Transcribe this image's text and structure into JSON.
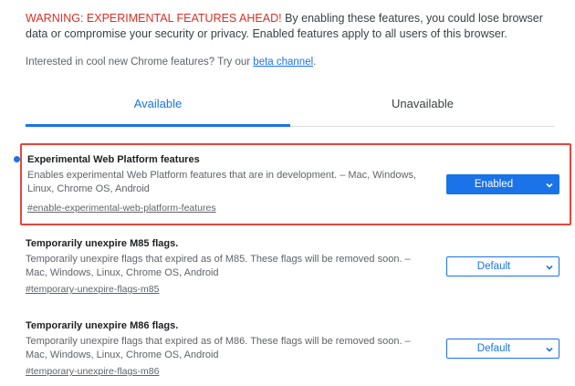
{
  "warning": {
    "heading": "WARNING: EXPERIMENTAL FEATURES AHEAD!",
    "body": " By enabling these features, you could lose browser data or compromise your security or privacy. Enabled features apply to all users of this browser."
  },
  "interest": {
    "text": "Interested in cool new Chrome features? Try our ",
    "link": "beta channel",
    "suffix": "."
  },
  "tabs": [
    {
      "label": "Available",
      "active": true
    },
    {
      "label": "Unavailable",
      "active": false
    }
  ],
  "flags": [
    {
      "title": "Experimental Web Platform features",
      "description": "Enables experimental Web Platform features that are in development. – Mac, Windows, Linux, Chrome OS, Android",
      "link": "#enable-experimental-web-platform-features",
      "value": "Enabled",
      "highlighted": true
    },
    {
      "title": "Temporarily unexpire M85 flags.",
      "description": "Temporarily unexpire flags that expired as of M85. These flags will be removed soon. – Mac, Windows, Linux, Chrome OS, Android",
      "link": "#temporary-unexpire-flags-m85",
      "value": "Default",
      "highlighted": false
    },
    {
      "title": "Temporarily unexpire M86 flags.",
      "description": "Temporarily unexpire flags that expired as of M86. These flags will be removed soon. – Mac, Windows, Linux, Chrome OS, Android",
      "link": "#temporary-unexpire-flags-m86",
      "value": "Default",
      "highlighted": false
    }
  ],
  "colors": {
    "accent": "#1a73e8",
    "warning": "#d93025",
    "highlight_border": "#e8453c"
  },
  "icons": {
    "modified": "blue-dot-icon",
    "dropdown": "chevron-down-icon"
  }
}
